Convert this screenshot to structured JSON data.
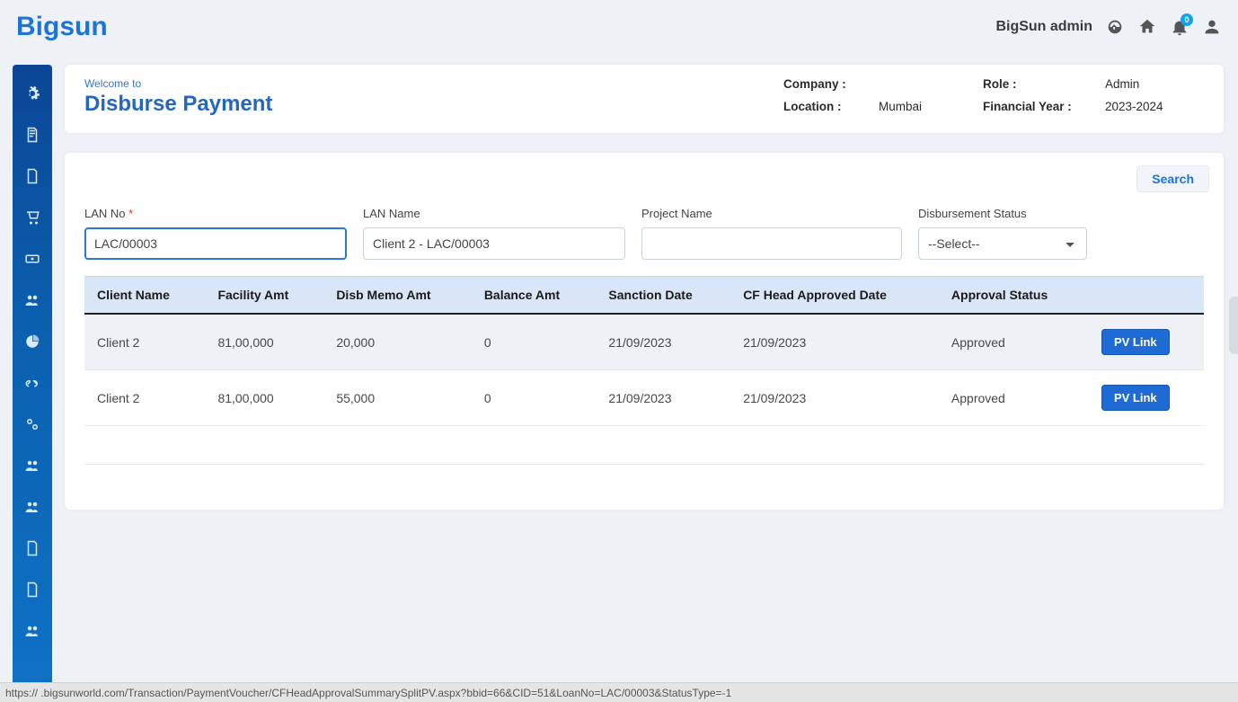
{
  "brand": "Bigsun",
  "topbar": {
    "username": "BigSun admin",
    "notification_count": "0"
  },
  "header": {
    "welcome": "Welcome to",
    "title": "Disburse Payment",
    "meta": {
      "company_label": "Company :",
      "company_value": "",
      "role_label": "Role :",
      "role_value": "Admin",
      "location_label": "Location :",
      "location_value": "Mumbai",
      "fy_label": "Financial Year :",
      "fy_value": "2023-2024"
    }
  },
  "filters": {
    "search_label": "Search",
    "lan_no": {
      "label": "LAN No",
      "value": "LAC/00003"
    },
    "lan_name": {
      "label": "LAN Name",
      "value": "Client 2 - LAC/00003"
    },
    "project_name": {
      "label": "Project Name",
      "value": ""
    },
    "disb_status": {
      "label": "Disbursement Status",
      "selected": "--Select--"
    }
  },
  "table": {
    "headers": [
      "Client Name",
      "Facility Amt",
      "Disb Memo Amt",
      "Balance Amt",
      "Sanction Date",
      "CF Head Approved Date",
      "Approval Status",
      ""
    ],
    "rows": [
      {
        "client": "Client 2",
        "facility": "81,00,000",
        "memo": "20,000",
        "balance": "0",
        "sanction": "21/09/2023",
        "cfhead": "21/09/2023",
        "status": "Approved",
        "link": "PV Link"
      },
      {
        "client": "Client 2",
        "facility": "81,00,000",
        "memo": "55,000",
        "balance": "0",
        "sanction": "21/09/2023",
        "cfhead": "21/09/2023",
        "status": "Approved",
        "link": "PV Link"
      }
    ]
  },
  "status_bar": "https://       .bigsunworld.com/Transaction/PaymentVoucher/CFHeadApprovalSummarySplitPV.aspx?bbid=66&CID=51&LoanNo=LAC/00003&StatusType=-1"
}
